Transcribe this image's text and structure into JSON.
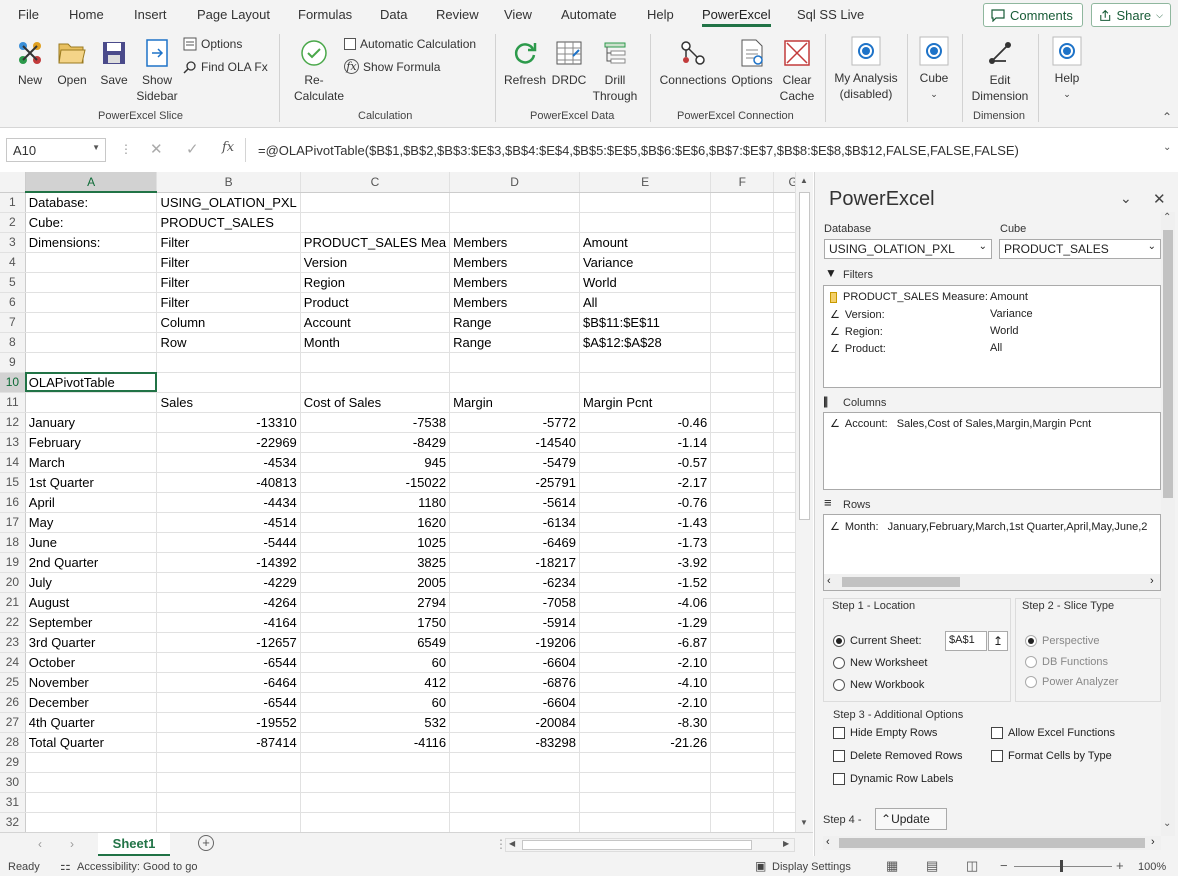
{
  "menu": {
    "tabs": [
      "File",
      "Home",
      "Insert",
      "Page Layout",
      "Formulas",
      "Data",
      "Review",
      "View",
      "Automate",
      "Help",
      "PowerExcel",
      "Sql SS Live"
    ],
    "active": "PowerExcel",
    "comments_label": "Comments",
    "share_label": "Share"
  },
  "ribbon": {
    "slice": {
      "new": "New",
      "open": "Open",
      "save": "Save",
      "show_sidebar": "Show Sidebar",
      "options": "Options",
      "find_ola": "Find OLA Fx",
      "group": "PowerExcel Slice"
    },
    "calc": {
      "recalc": "Re-Calculate",
      "auto_calc": "Automatic Calculation",
      "show_formula": "Show Formula",
      "group": "Calculation"
    },
    "data": {
      "refresh": "Refresh",
      "drdc": "DRDC",
      "drill": "Drill Through",
      "group": "PowerExcel Data"
    },
    "conn": {
      "connections": "Connections",
      "options": "Options",
      "clear_cache": "Clear Cache",
      "group": "PowerExcel Connection"
    },
    "analysis": {
      "my_analysis": "My Analysis (disabled)"
    },
    "cube": {
      "cube": "Cube"
    },
    "dim": {
      "edit_dimension": "Edit Dimension",
      "group": "Dimension"
    },
    "help": {
      "help": "Help"
    }
  },
  "formula_bar": {
    "name_box": "A10",
    "formula": "=@OLAPivotTable($B$1,$B$2,$B$3:$E$3,$B$4:$E$4,$B$5:$E$5,$B$6:$E$6,$B$7:$E$7,$B$8:$E$8,$B$12,FALSE,FALSE,FALSE)"
  },
  "grid": {
    "columns": [
      "A",
      "B",
      "C",
      "D",
      "E",
      "F",
      "G"
    ],
    "rows": [
      [
        "Database:",
        "USING_OLATION_PXL",
        "",
        "",
        "",
        ""
      ],
      [
        "Cube:",
        "PRODUCT_SALES",
        "",
        "",
        "",
        ""
      ],
      [
        "Dimensions:",
        "Filter",
        "PRODUCT_SALES Mea",
        "Members",
        "Amount",
        ""
      ],
      [
        "",
        "Filter",
        "Version",
        "Members",
        "Variance",
        ""
      ],
      [
        "",
        "Filter",
        "Region",
        "Members",
        "World",
        ""
      ],
      [
        "",
        "Filter",
        "Product",
        "Members",
        "All",
        ""
      ],
      [
        "",
        "Column",
        "Account",
        "Range",
        "$B$11:$E$11",
        ""
      ],
      [
        "",
        "Row",
        "Month",
        "Range",
        "$A$12:$A$28",
        ""
      ],
      [
        "",
        "",
        "",
        "",
        "",
        ""
      ],
      [
        "OLAPivotTable",
        "",
        "",
        "",
        "",
        ""
      ],
      [
        "",
        "Sales",
        "Cost of Sales",
        "Margin",
        "Margin Pcnt",
        ""
      ],
      [
        "January",
        "-13310",
        "-7538",
        "-5772",
        "-0.46",
        ""
      ],
      [
        "February",
        "-22969",
        "-8429",
        "-14540",
        "-1.14",
        ""
      ],
      [
        "March",
        "-4534",
        "945",
        "-5479",
        "-0.57",
        ""
      ],
      [
        "1st Quarter",
        "-40813",
        "-15022",
        "-25791",
        "-2.17",
        ""
      ],
      [
        "April",
        "-4434",
        "1180",
        "-5614",
        "-0.76",
        ""
      ],
      [
        "May",
        "-4514",
        "1620",
        "-6134",
        "-1.43",
        ""
      ],
      [
        "June",
        "-5444",
        "1025",
        "-6469",
        "-1.73",
        ""
      ],
      [
        "2nd Quarter",
        "-14392",
        "3825",
        "-18217",
        "-3.92",
        ""
      ],
      [
        "July",
        "-4229",
        "2005",
        "-6234",
        "-1.52",
        ""
      ],
      [
        "August",
        "-4264",
        "2794",
        "-7058",
        "-4.06",
        ""
      ],
      [
        "September",
        "-4164",
        "1750",
        "-5914",
        "-1.29",
        ""
      ],
      [
        "3rd Quarter",
        "-12657",
        "6549",
        "-19206",
        "-6.87",
        ""
      ],
      [
        "October",
        "-6544",
        "60",
        "-6604",
        "-2.10",
        ""
      ],
      [
        "November",
        "-6464",
        "412",
        "-6876",
        "-4.10",
        ""
      ],
      [
        "December",
        "-6544",
        "60",
        "-6604",
        "-2.10",
        ""
      ],
      [
        "4th Quarter",
        "-19552",
        "532",
        "-20084",
        "-8.30",
        ""
      ],
      [
        "Total Quarter",
        "-87414",
        "-4116",
        "-83298",
        "-21.26",
        ""
      ],
      [
        "",
        "",
        "",
        "",
        "",
        ""
      ],
      [
        "",
        "",
        "",
        "",
        "",
        ""
      ],
      [
        "",
        "",
        "",
        "",
        "",
        ""
      ],
      [
        "",
        "",
        "",
        "",
        "",
        ""
      ]
    ]
  },
  "sheet": {
    "tab": "Sheet1"
  },
  "status": {
    "ready": "Ready",
    "accessibility": "Accessibility: Good to go",
    "display_settings": "Display Settings",
    "zoom": "100%"
  },
  "panel": {
    "title": "PowerExcel",
    "database_label": "Database",
    "database_value": "USING_OLATION_PXL",
    "cube_label": "Cube",
    "cube_value": "PRODUCT_SALES",
    "filters_label": "Filters",
    "filters": [
      {
        "name": "PRODUCT_SALES Measure:",
        "value": "Amount"
      },
      {
        "name": "Version:",
        "value": "Variance"
      },
      {
        "name": "Region:",
        "value": "World"
      },
      {
        "name": "Product:",
        "value": "All"
      }
    ],
    "columns_label": "Columns",
    "columns_name": "Account:",
    "columns_value": "Sales,Cost of Sales,Margin,Margin Pcnt",
    "rows_label": "Rows",
    "rows_name": "Month:",
    "rows_value": "January,February,March,1st Quarter,April,May,June,2",
    "step1": "Step 1 - Location",
    "step2": "Step 2 - Slice Type",
    "current_sheet": "Current Sheet:",
    "location_value": "$A$1",
    "new_worksheet": "New Worksheet",
    "new_workbook": "New Workbook",
    "perspective": "Perspective",
    "db_functions": "DB Functions",
    "power_analyzer": "Power Analyzer",
    "step3": "Step 3 - Additional Options",
    "hide_empty": "Hide Empty Rows",
    "allow_excel": "Allow Excel Functions",
    "delete_removed": "Delete Removed Rows",
    "format_cells": "Format Cells by Type",
    "dynamic_labels": "Dynamic Row Labels",
    "step4": "Step 4 -",
    "update": "Update"
  },
  "colors": {
    "excel_green": "#217346",
    "ribbon_bg": "#f3f3f3",
    "icon_blue": "#1e73c8"
  }
}
